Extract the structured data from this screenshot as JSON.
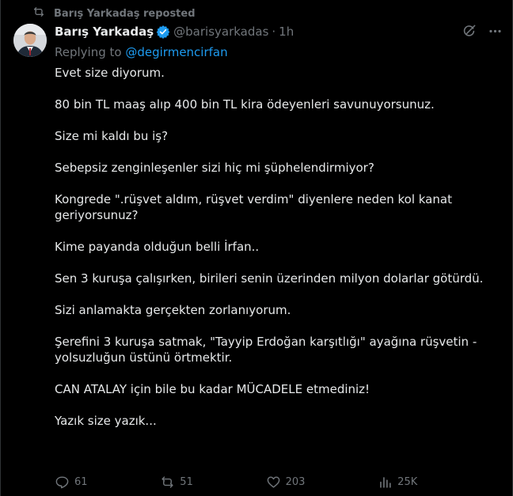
{
  "repost": {
    "text": "Barış Yarkadaş reposted",
    "icon": "repost-icon"
  },
  "author": {
    "display_name": "Barış Yarkadaş",
    "handle": "@barisyarkadas",
    "separator": "·",
    "time": "1h",
    "verified": true
  },
  "replying": {
    "prefix": "Replying to",
    "to": "@degirmencirfan"
  },
  "tweet": {
    "paragraphs": [
      "Evet size diyorum.",
      "80 bin TL maaş alıp 400 bin TL kira ödeyenleri savunuyorsunuz.",
      "Size mi kaldı bu iş?",
      "Sebepsiz zenginleşenler sizi hiç mi şüphelendirmiyor?",
      "Kongrede \".rüşvet aldım, rüşvet verdim\" diyenlere neden kol kanat geriyorsunuz?",
      "Kime payanda olduğun belli İrfan..",
      "Sen 3 kuruşa çalışırken, birileri senin üzerinden milyon dolarlar götürdü.",
      "Sizi anlamakta gerçekten zorlanıyorum.",
      "Şerefini 3 kuruşa satmak, \"Tayyip Erdoğan karşıtlığı\" ayağına rüşvetin - yolsuzluğun üstünü örtmektir.",
      "CAN ATALAY için bile bu kadar MÜCADELE etmediniz!",
      "Yazık size yazık..."
    ]
  },
  "metrics": {
    "replies": "61",
    "reposts": "51",
    "likes": "203",
    "views": "25K"
  },
  "colors": {
    "background": "#000000",
    "text": "#e7e9ea",
    "muted": "#71767b",
    "link": "#1d9bf0",
    "verified": "#1d9bf0"
  }
}
